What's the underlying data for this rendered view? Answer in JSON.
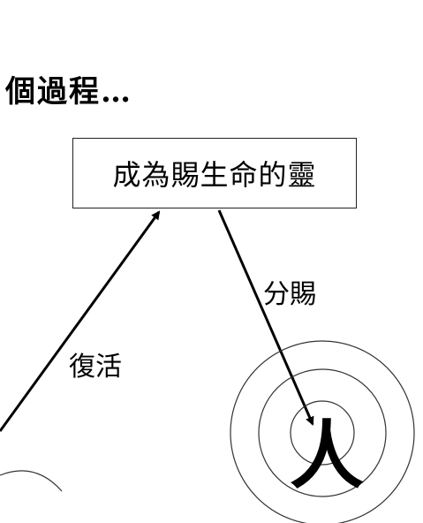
{
  "title": "個過程…",
  "box": {
    "label": "成為賜生命的靈"
  },
  "arrows": {
    "down_label": "分賜",
    "up_label": "復活"
  },
  "target": {
    "glyph": "人"
  }
}
